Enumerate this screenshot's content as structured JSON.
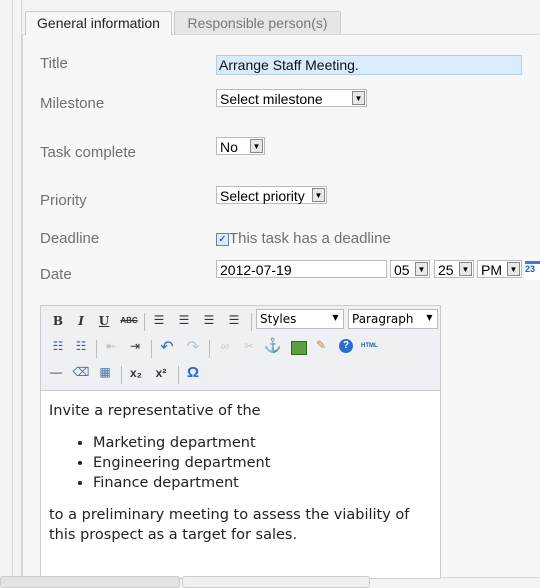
{
  "tabs": [
    {
      "label": "General information",
      "active": true
    },
    {
      "label": "Responsible person(s)",
      "active": false
    }
  ],
  "form": {
    "title_label": "Title",
    "title_value": "Arrange Staff Meeting.",
    "milestone_label": "Milestone",
    "milestone_value": "Select milestone",
    "task_complete_label": "Task complete",
    "task_complete_value": "No",
    "priority_label": "Priority",
    "priority_value": "Select priority",
    "deadline_label": "Deadline",
    "deadline_checkbox_label": "This task has a deadline",
    "deadline_checked": true,
    "date_label": "Date",
    "date_value": "2012-07-19",
    "hour": "05",
    "minute": "25",
    "ampm": "PM",
    "calendar_icon_text": "23"
  },
  "toolbar": {
    "styles": "Styles",
    "paragraph": "Paragraph",
    "bold": "B",
    "italic": "I",
    "underline": "U",
    "strike": "ABC",
    "undo": "↶",
    "redo": "↷",
    "html": "HTML",
    "subscript": "x₂",
    "superscript": "x²",
    "omega": "Ω",
    "anchor": "⚓",
    "help": "?"
  },
  "editor": {
    "intro": "Invite a representative of the",
    "items": [
      "Marketing department",
      "Engineering department",
      "Finance department"
    ],
    "outro": "to a preliminary meeting to assess the viability of this prospect as a target for sales."
  }
}
